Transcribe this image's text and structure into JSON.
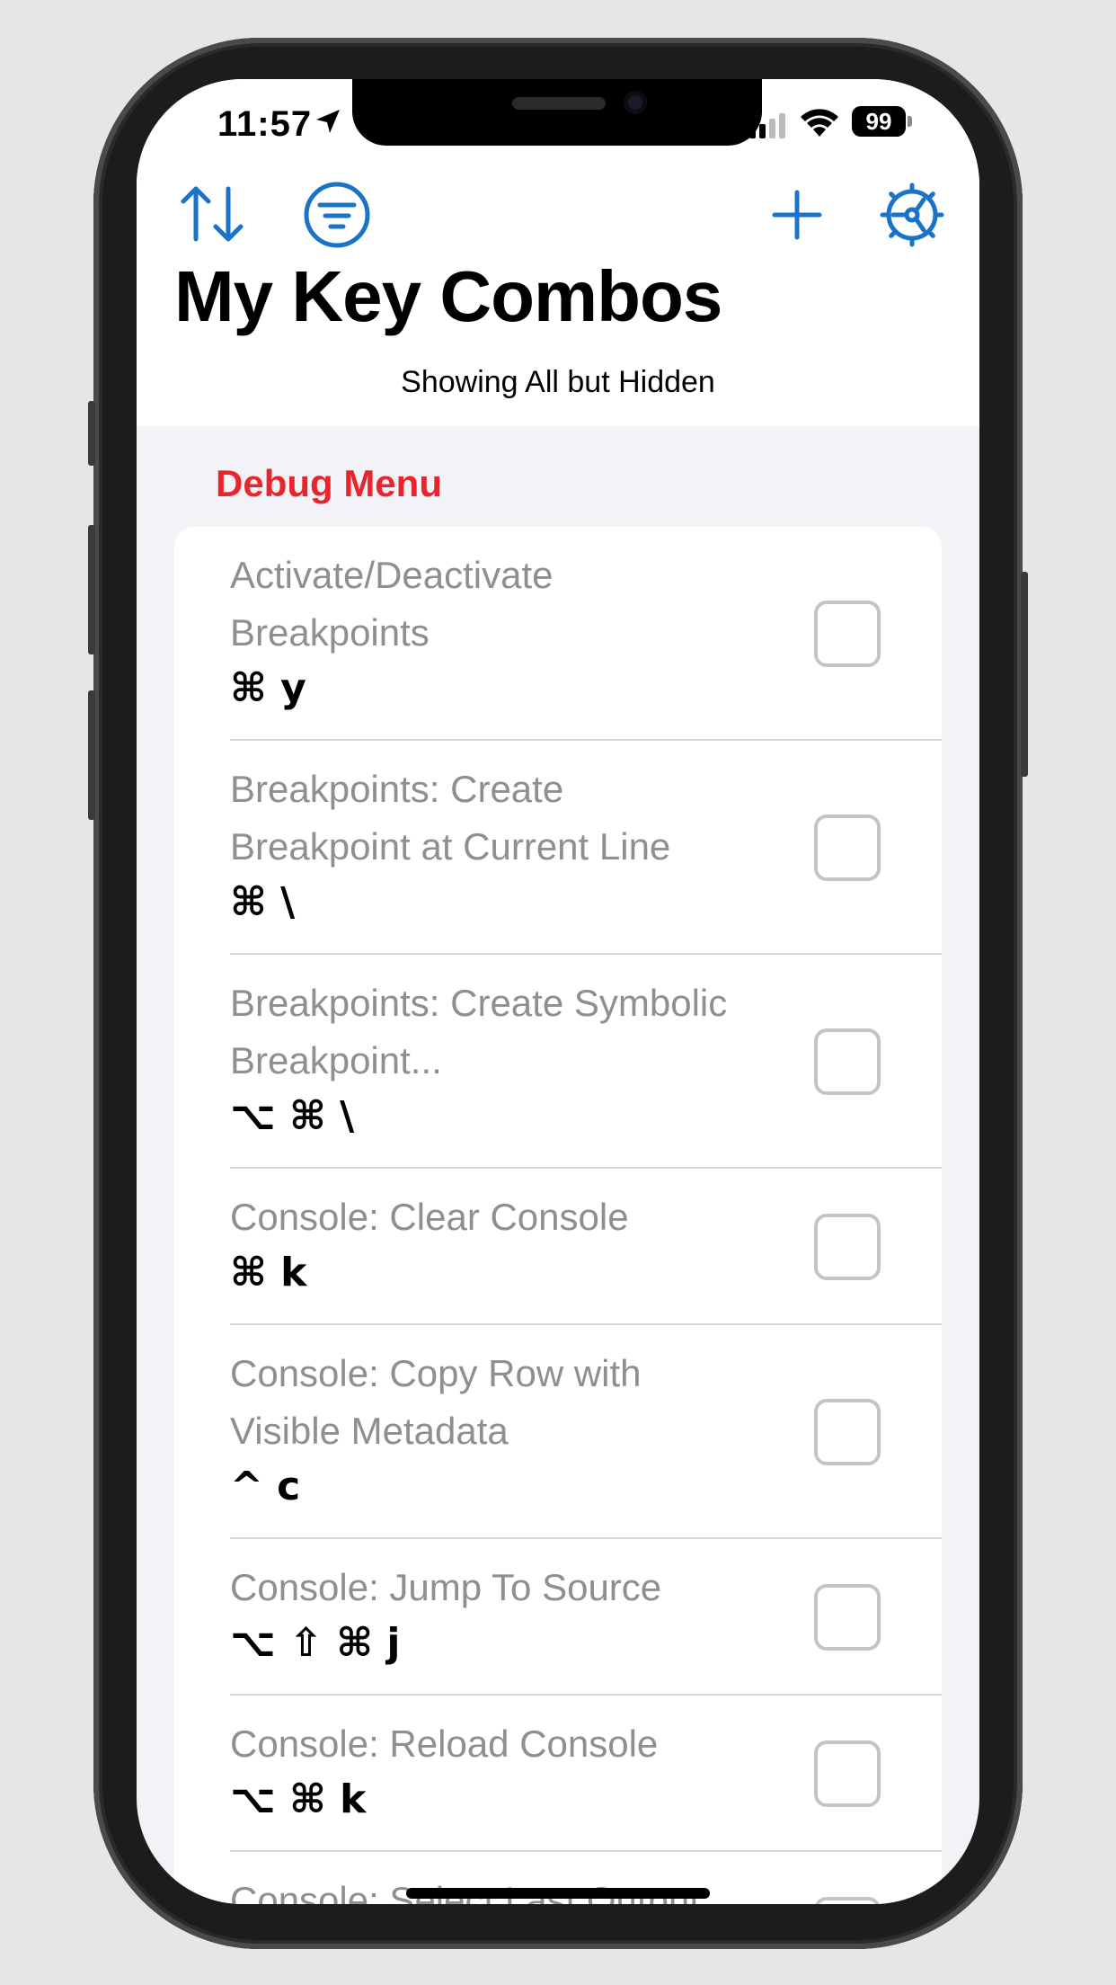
{
  "status_bar": {
    "time": "11:57",
    "battery": "99"
  },
  "header": {
    "title": "My Key Combos",
    "subtitle": "Showing All but Hidden"
  },
  "icons": {
    "sort": "sort-arrows-icon",
    "filter": "filter-icon",
    "add": "plus-icon",
    "settings": "gear-icon"
  },
  "accent_color": "#1a73c8",
  "section": {
    "title": "Debug Menu",
    "color": "#e8252c"
  },
  "items": [
    {
      "name_lines": [
        "Activate/Deactivate",
        "Breakpoints"
      ],
      "keys": "⌘ y",
      "checked": false
    },
    {
      "name_lines": [
        "Breakpoints: Create",
        "Breakpoint at Current Line"
      ],
      "keys": "⌘ \\",
      "checked": false
    },
    {
      "name_lines": [
        "Breakpoints: Create Symbolic",
        "Breakpoint..."
      ],
      "keys": "⌥ ⌘ \\",
      "checked": false
    },
    {
      "name_lines": [
        "Console: Clear Console"
      ],
      "keys": "⌘ k",
      "checked": false
    },
    {
      "name_lines": [
        "Console: Copy Row with",
        "Visible Metadata"
      ],
      "keys": "^ c",
      "checked": false
    },
    {
      "name_lines": [
        "Console: Jump To Source"
      ],
      "keys": "⌥ ⇧ ⌘ j",
      "checked": false
    },
    {
      "name_lines": [
        "Console: Reload Console"
      ],
      "keys": "⌥ ⌘ k",
      "checked": false
    },
    {
      "name_lines": [
        "Console: Select Last Output"
      ],
      "keys": "",
      "checked": false
    }
  ]
}
